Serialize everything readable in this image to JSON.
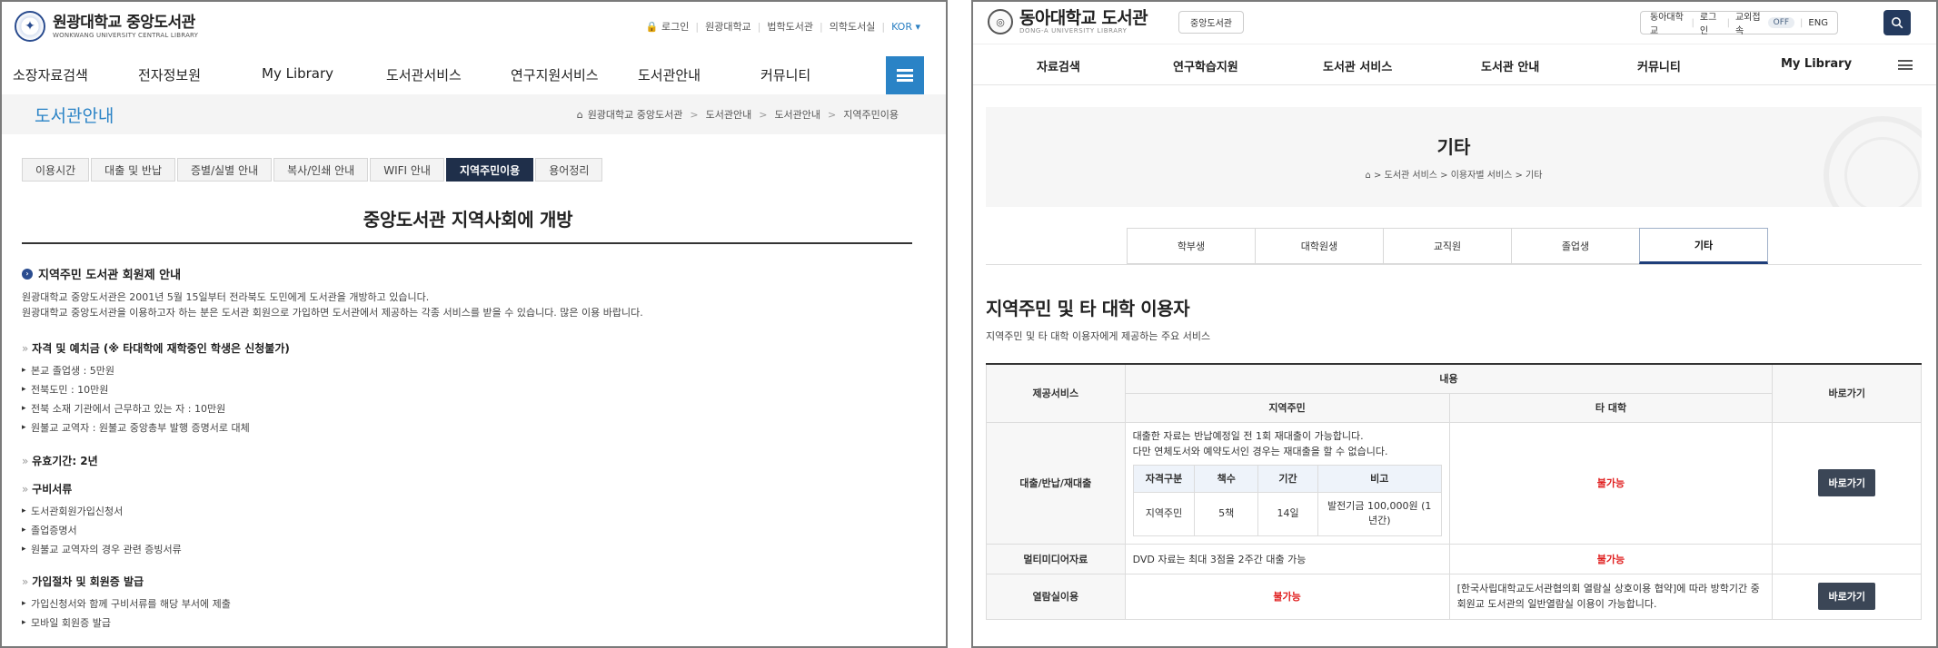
{
  "left": {
    "logo": {
      "title": "원광대학교 중앙도서관",
      "sub": "WONKWANG UNIVERSITY CENTRAL LIBRARY"
    },
    "util": [
      "🔒 로그인",
      "원광대학교",
      "법학도서관",
      "의학도서실",
      "KOR ▾"
    ],
    "gnb": [
      "소장자료검색",
      "전자정보원",
      "My Library",
      "도서관서비스",
      "연구지원서비스",
      "도서관안내",
      "커뮤니티"
    ],
    "subhead": {
      "title": "도서관안내",
      "crumbs": [
        "원광대학교 중앙도서관",
        "도서관안내",
        "도서관안내",
        "지역주민이용"
      ]
    },
    "tabs": [
      "이용시간",
      "대출 및 반납",
      "증별/실별 안내",
      "복사/인쇄 안내",
      "WIFI 안내",
      "지역주민이용",
      "용어정리"
    ],
    "active_tab": 5,
    "heading": "중앙도서관 지역사회에 개방",
    "section": {
      "title": "지역주민 도서관 회원제 안내",
      "intro": [
        "원광대학교 중앙도서관은 2001년 5월 15일부터 전라북도 도민에게 도서관을 개방하고 있습니다.",
        "원광대학교 중앙도서관을 이용하고자 하는 분은 도서관 회원으로 가입하면 도서관에서 제공하는 각종 서비스를 받을 수 있습니다. 많은 이용 바랍니다."
      ],
      "qualification": {
        "title": "자격 및 예치금 (※ 타대학에 재학중인 학생은 신청불가)",
        "items": [
          "본교 졸업생 : 5만원",
          "전북도민 : 10만원",
          "전북 소재 기관에서 근무하고 있는 자 : 10만원",
          "원불교 교역자 : 원불교 중앙총부 발행 증명서로 대체"
        ]
      },
      "period": {
        "title": "유효기간: 2년"
      },
      "documents": {
        "title": "구비서류",
        "items": [
          "도서관회원가입신청서",
          "졸업증명서",
          "원불교 교역자의 경우 관련 증빙서류"
        ]
      },
      "procedure": {
        "title": "가입절차 및 회원증 발급",
        "items": [
          "가입신청서와 함께 구비서류를 해당 부서에 제출",
          "모바일 회원증 발급"
        ]
      }
    }
  },
  "right": {
    "logo": {
      "title": "동아대학교 도서관",
      "sub": "DONG-A UNIVERSITY LIBRARY"
    },
    "lib_button": "중앙도서관",
    "util": {
      "univ": "동아대학교",
      "login": "로그인",
      "staff": "교외접속",
      "toggle": "OFF",
      "lang": "ENG"
    },
    "gnb": [
      "자료검색",
      "연구학습지원",
      "도서관 서비스",
      "도서관 안내",
      "커뮤니티",
      "My Library"
    ],
    "visual": {
      "title": "기타",
      "crumb": "⌂ > 도서관 서비스 > 이용자별 서비스 > 기타"
    },
    "tabs": [
      "학부생",
      "대학원생",
      "교직원",
      "졸업생",
      "기타"
    ],
    "active_tab": 4,
    "heading": "지역주민 및 타 대학 이용자",
    "desc": "지역주민 및 타 대학 이용자에게 제공하는 주요 서비스",
    "table": {
      "head": {
        "service": "제공서비스",
        "content": "내용",
        "local": "지역주민",
        "other": "타 대학",
        "go": "바로가기"
      },
      "row1": {
        "label": "대출/반납/재대출",
        "text1": "대출한 자료는 반납예정일 전 1회 재대출이 가능합니다.",
        "text2": "다만 연체도서와 예약도서인 경우는 재대출을 할 수 없습니다.",
        "inner_head": [
          "자격구분",
          "책수",
          "기간",
          "비고"
        ],
        "inner_row": [
          "지역주민",
          "5책",
          "14일",
          "발전기금 100,000원 (1년간)"
        ],
        "other": "불가능",
        "button": "바로가기"
      },
      "row2": {
        "label": "멀티미디어자료",
        "local": "DVD 자료는 최대 3점을 2주간 대출 가능",
        "other": "불가능"
      },
      "row3": {
        "label": "열람실이용",
        "local": "불가능",
        "other": "[한국사립대학교도서관협의회 열람실 상호이용 협약]에 따라 방학기간 중 회원교 도서관의 일반열람실 이용이 가능합니다.",
        "button": "바로가기"
      }
    }
  },
  "colors": {
    "left_accent": "#2a83c6",
    "left_tab_active": "#1f2f4a",
    "right_accent": "#1f3e7a",
    "red": "#e02020"
  }
}
